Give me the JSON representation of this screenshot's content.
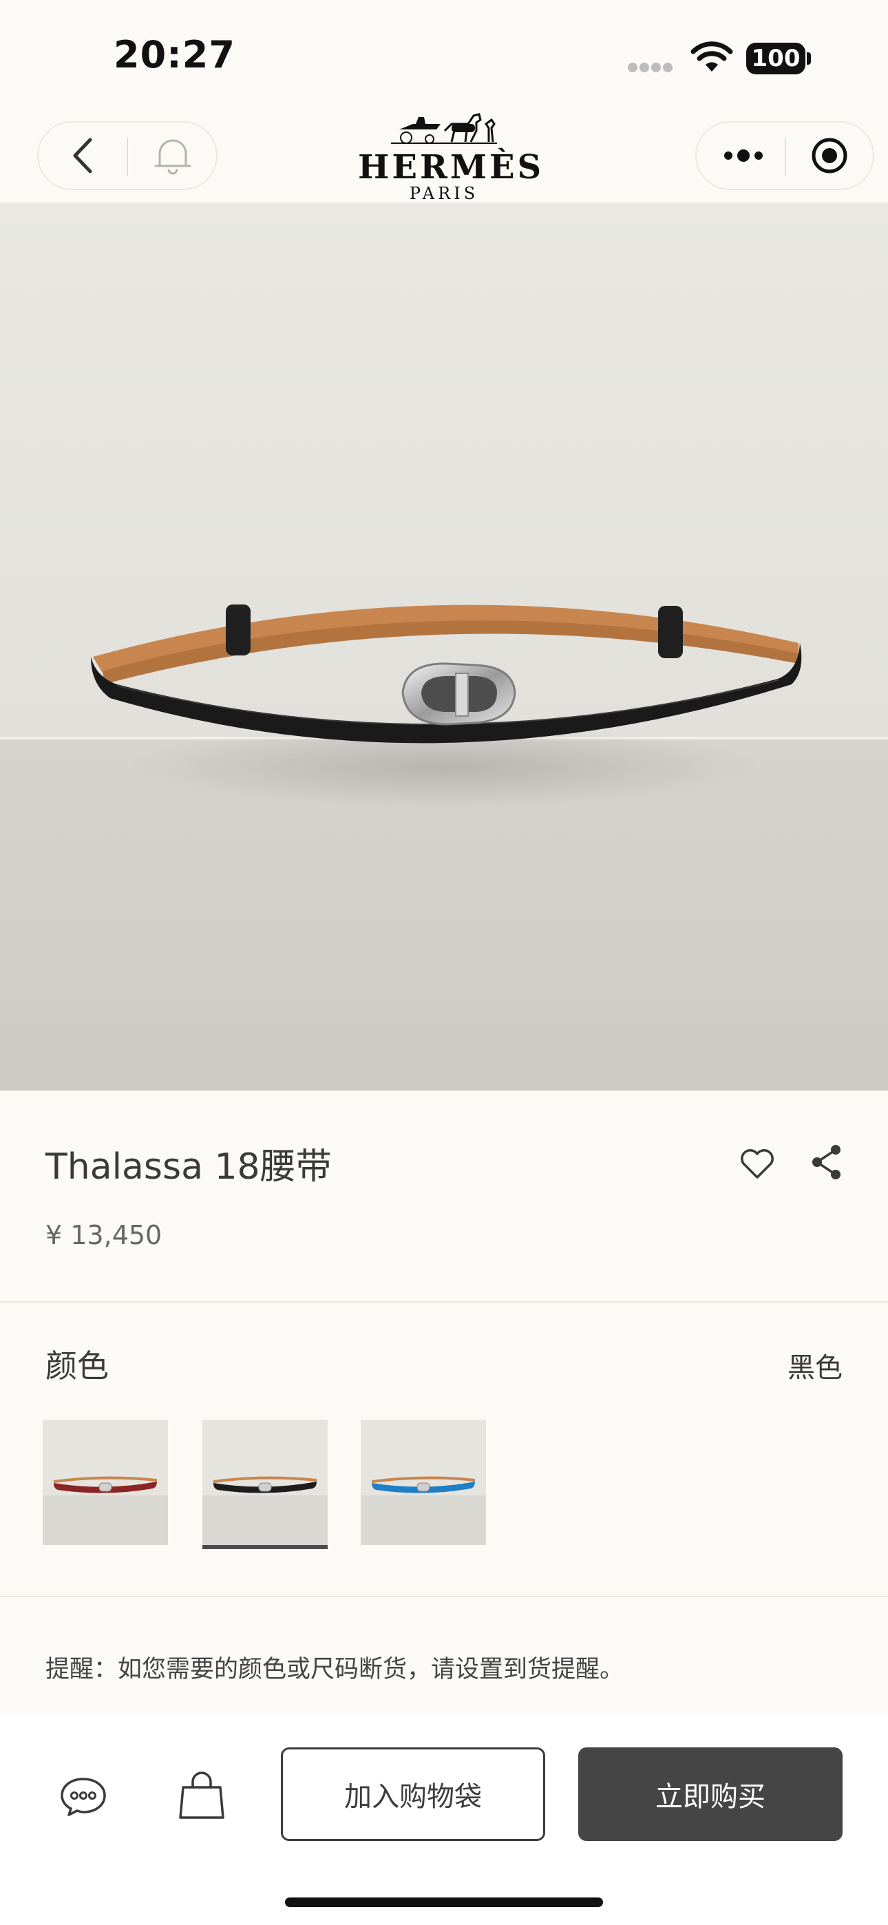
{
  "status_bar": {
    "time": "20:27",
    "battery": "100"
  },
  "brand": {
    "name": "HERMÈS",
    "sub": "PARIS"
  },
  "nav": {
    "icons": [
      "back-arrow-icon",
      "bell-icon",
      "more-dots-icon",
      "record-target-icon"
    ]
  },
  "gallery": {
    "slide_count": 5,
    "active_index": 0
  },
  "product": {
    "title": "Thalassa 18腰带",
    "price": "¥ 13,450",
    "color_label": "颜色",
    "selected_color": "黑色",
    "swatches": [
      {
        "belt_color": "#8b2424"
      },
      {
        "belt_color": "#1d1d1d"
      },
      {
        "belt_color": "#1e7fc6"
      }
    ],
    "selected_swatch": 1,
    "reminder": "提醒：如您需要的颜色或尺码断货，请设置到货提醒。"
  },
  "actions": {
    "add_to_bag": "加入购物袋",
    "buy_now": "立即购买"
  },
  "colors": {
    "background": "#fcfaf6",
    "primary_button": "#454545",
    "belt_leather": "#1a1a1a",
    "belt_lining": "#c8864e"
  }
}
